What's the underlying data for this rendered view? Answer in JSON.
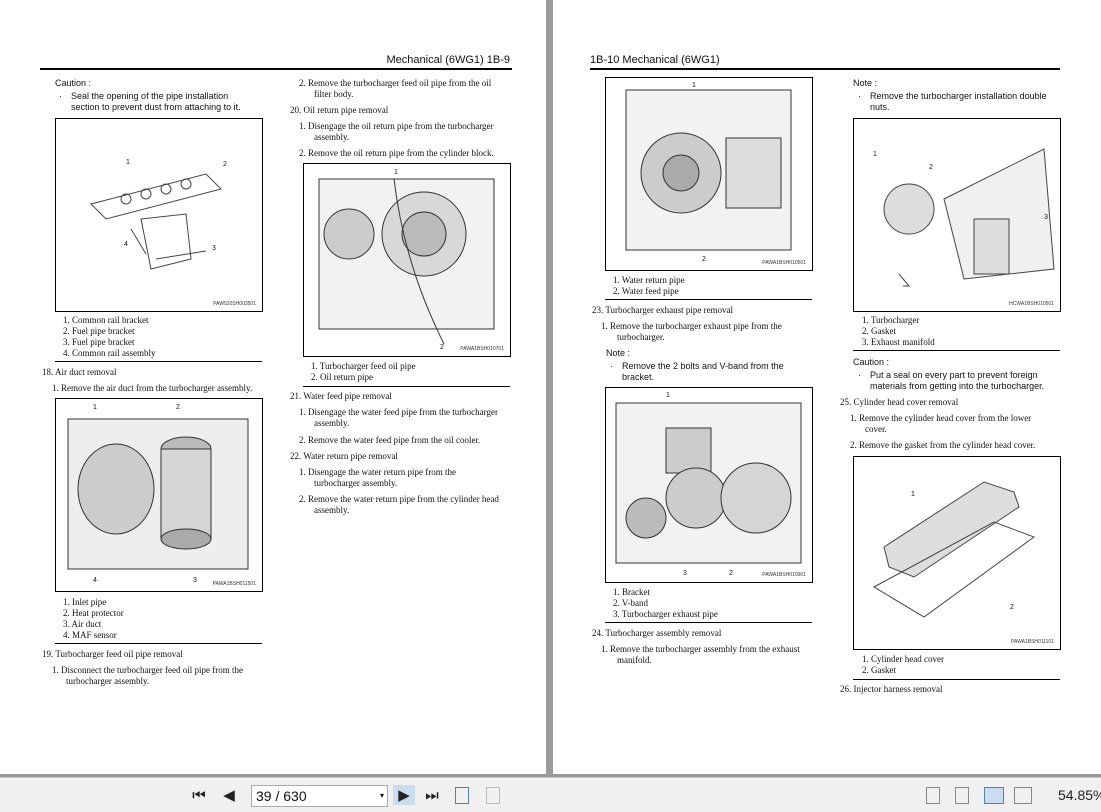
{
  "left_page": {
    "header": "Mechanical (6WG1)   1B-9",
    "caution1": {
      "label": "Caution :",
      "bullet": "·",
      "lines": [
        "Seal the opening of the pipe installation",
        "section to prevent dust from attaching to it."
      ]
    },
    "fig1": {
      "id": "PAW520SH003501",
      "callouts": [
        "1",
        "2",
        "3",
        "4"
      ]
    },
    "legend1": [
      "1.   Common rail bracket",
      "2.   Fuel pipe bracket",
      "3.   Fuel pipe bracket",
      "4.   Common rail assembly"
    ],
    "step18": "18.  Air duct  removal",
    "step18_1": "1.    Remove the air duct from the turbocharger assembly.",
    "fig2": {
      "id": "PAWA1BSH011501",
      "callouts": [
        "1",
        "2",
        "3",
        "4"
      ]
    },
    "legend2": [
      "1.   Inlet pipe",
      "2.   Heat protector",
      "3.   Air duct",
      "4.   MAF sensor"
    ],
    "step19": "19.  Turbocharger feed oil pipe  removal",
    "step19_1": [
      "1.    Disconnect the turbocharger feed oil pipe from the",
      "turbocharger assembly."
    ],
    "step19_2": [
      "2.    Remove the turbocharger feed oil pipe from the oil",
      "filter body."
    ],
    "step20": "20.  Oil return pipe  removal",
    "step20_1": [
      "1.    Disengage the oil return pipe from the turbocharger",
      "assembly."
    ],
    "step20_2": "2.    Remove the oil return pipe from the cylinder block.",
    "fig3": {
      "id": "PAWA1BSH010701",
      "callouts": [
        "1",
        "2"
      ]
    },
    "legend3": [
      "1.   Turbocharger feed oil pipe",
      "2.   Oil return pipe"
    ],
    "step21": "21.  Water feed pipe  removal",
    "step21_1": [
      "1.    Disengage the water feed pipe from the turbocharger",
      "assembly."
    ],
    "step21_2": "2.    Remove the water feed pipe from the oil cooler.",
    "step22": "22.  Water return pipe  removal",
    "step22_1": [
      "1.    Disengage the water return pipe from the",
      "turbocharger assembly."
    ],
    "step22_2": [
      "2.    Remove the water return pipe from the cylinder head",
      "assembly."
    ]
  },
  "right_page": {
    "header": "1B-10   Mechanical (6WG1)",
    "fig4": {
      "id": "PAWA1BSH010501",
      "callouts": [
        "1",
        "2"
      ]
    },
    "legend4": [
      "1.   Water return pipe",
      "2.   Water feed pipe"
    ],
    "step23": "23.  Turbocharger exhaust pipe  removal",
    "step23_1": [
      "1.    Remove the turbocharger exhaust pipe from the",
      "turbocharger."
    ],
    "note23": {
      "label": "Note :",
      "bullet": "·",
      "lines": [
        "Remove the 2 bolts and V-band from the",
        "bracket."
      ]
    },
    "fig5": {
      "id": "PAWA1BSH010901",
      "callouts": [
        "1",
        "2",
        "3"
      ]
    },
    "legend5": [
      "1.   Bracket",
      "2.   V-band",
      "3.   Turbocharger exhaust pipe"
    ],
    "step24": "24.  Turbocharger assembly  removal",
    "step24_1": [
      "1.    Remove the turbocharger assembly from the exhaust",
      "manifold."
    ],
    "note_top": {
      "label": "Note :",
      "bullet": "·",
      "lines": [
        "Remove the turbocharger installation double",
        "nuts."
      ]
    },
    "fig6": {
      "id": "HCWA1BSH010501",
      "callouts": [
        "1",
        "2",
        "3"
      ]
    },
    "legend6": [
      "1.   Turbocharger",
      "2.   Gasket",
      "3.   Exhaust manifold"
    ],
    "caution2": {
      "label": "Caution :",
      "bullet": "·",
      "lines": [
        "Put a seal on every part to prevent foreign",
        "materials from getting into the turbocharger."
      ]
    },
    "step25": "25.  Cylinder head cover  removal",
    "step25_1": [
      "1.    Remove the cylinder head cover from the lower",
      "cover."
    ],
    "step25_2": "2.    Remove the gasket from the cylinder head cover.",
    "fig7": {
      "id": "PAWA1BSH011101",
      "callouts": [
        "1",
        "2"
      ]
    },
    "legend7": [
      "1.   Cylinder head cover",
      "2.   Gasket"
    ],
    "step26": "26.  Injector harness  removal"
  },
  "toolbar": {
    "first_icon": "⏮",
    "prev_icon": "◀",
    "next_icon": "▶",
    "last_icon": "⏭",
    "page_value": "39 / 630",
    "dropdown_icon": "▾",
    "zoom": "54.85%"
  }
}
